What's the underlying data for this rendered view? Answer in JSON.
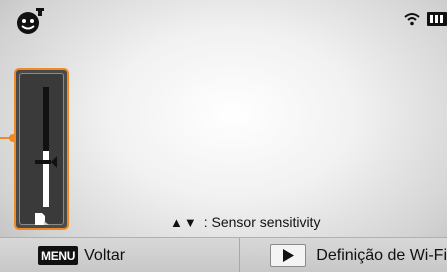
{
  "status_bar": {
    "mode_icon": "smart-face-mode-icon",
    "wifi_icon": "wifi-icon",
    "battery_icon": "battery-icon"
  },
  "sensitivity_slider": {
    "level": 0.47,
    "bottom_icon": "sensor-icon",
    "accent_color": "#f08a24"
  },
  "hint": {
    "arrows": "▲▼",
    "text": ": Sensor sensitivity"
  },
  "bottom_bar": {
    "menu_key": "MENU",
    "back_label": "Voltar",
    "play_icon": "play-icon",
    "wifi_setting_label": "Definição de Wi-Fi"
  }
}
